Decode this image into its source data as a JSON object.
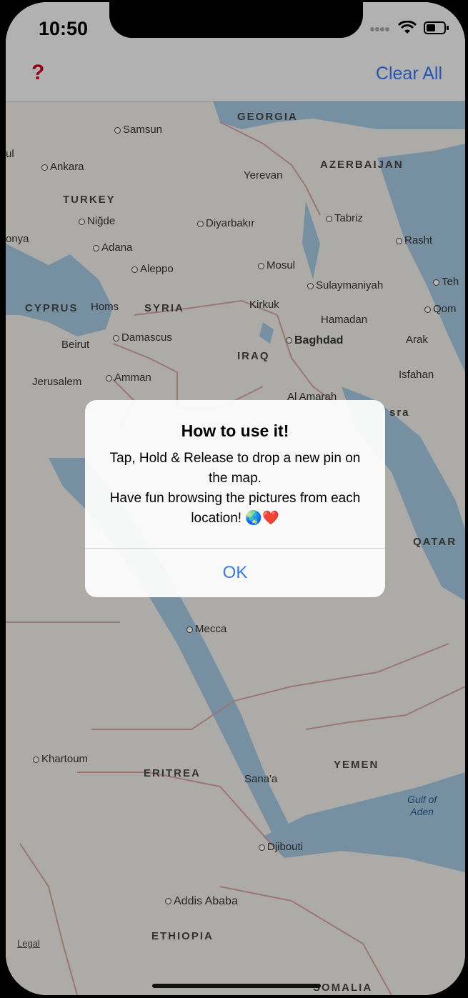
{
  "status": {
    "time": "10:50"
  },
  "navbar": {
    "help_label": "?",
    "clear_label": "Clear All"
  },
  "map": {
    "cities": [
      "Samsun",
      "Ankara",
      "Yerevan",
      "Niğde",
      "Diyarbakır",
      "Tabriz",
      "onya",
      "Adana",
      "Rasht",
      "Mosul",
      "Aleppo",
      "Sulaymaniyah",
      "Teh",
      "Homs",
      "Kirkuk",
      "Qom",
      "Hamadan",
      "Beirut",
      "Damascus",
      "Baghdad",
      "Arak",
      "Amman",
      "Isfahan",
      "Jerusalem",
      "Al Amarah",
      "Mecca",
      "Khartoum",
      "Sana'a",
      "Djibouti",
      "Addis Ababa",
      "sra",
      "ul"
    ],
    "countries": [
      "GEORGIA",
      "AZERBAIJAN",
      "TURKEY",
      "CYPRUS",
      "SYRIA",
      "IRAQ",
      "QATAR",
      "ERITREA",
      "YEMEN",
      "ETHIOPIA",
      "SOMALIA"
    ],
    "water": "Gulf of\nAden",
    "legal": "Legal"
  },
  "alert": {
    "title": "How to use it!",
    "message": "Tap, Hold & Release to drop a new pin on the map.\nHave fun browsing the pictures from each location! 🌏❤️",
    "ok_label": "OK"
  }
}
